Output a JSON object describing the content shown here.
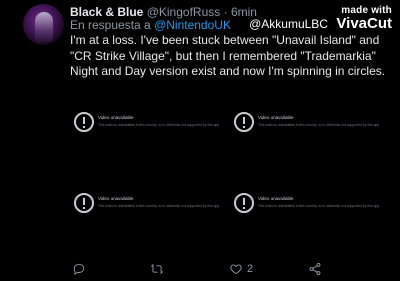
{
  "tweet": {
    "display_name": "Black & Blue",
    "handle": "@KingofRuss",
    "separator": "·",
    "time": "6min",
    "reply_prefix": "En respuesta a",
    "reply_to": "@NintendoUK",
    "text": "I'm at a loss. I've been stuck between \"Unavail Island\" and \"CR Strike Village\", but then I remembered \"Trademarkia\" Night and Day version exist and now I'm spinning in circles."
  },
  "watermark": {
    "made_with": "made with",
    "user": "@AkkumuLBC",
    "brand": "VivaCut"
  },
  "media": [
    {
      "status": "Video unavailable",
      "detail": "This video is unavailable in this country, or is otherwise not supported by this app"
    },
    {
      "status": "Video unavailable",
      "detail": "This video is unavailable in this country, or is otherwise not supported by this app"
    },
    {
      "status": "Video unavailable",
      "detail": "This video is unavailable in this country, or is otherwise not supported by this app"
    },
    {
      "status": "Video unavailable",
      "detail": "This video is unavailable in this country, or is otherwise not supported by this app"
    }
  ],
  "actions": {
    "reply_icon": "reply-icon",
    "retweet_icon": "retweet-icon",
    "like_icon": "heart-icon",
    "like_count": "2",
    "share_icon": "share-icon"
  },
  "colors": {
    "background": "#000000",
    "text": "#e7e9ea",
    "muted": "#8b98a5",
    "accent": "#1d9bf0"
  }
}
